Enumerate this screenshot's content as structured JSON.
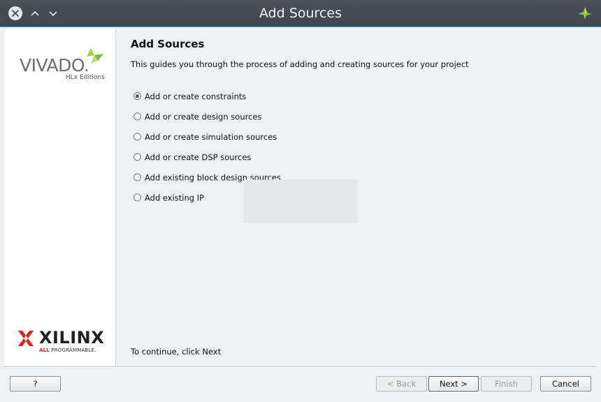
{
  "window": {
    "title": "Add Sources"
  },
  "sidebar": {
    "vivado_wordmark": "VIVADO.",
    "vivado_edition": "HLx Editions",
    "xilinx_wordmark": "XILINX",
    "xilinx_tagline_all": "ALL",
    "xilinx_tagline_rest": " PROGRAMMABLE."
  },
  "main": {
    "heading": "Add Sources",
    "description": "This guides you through the process of adding and creating sources for your project",
    "options": [
      {
        "label": "Add or create constraints",
        "selected": true
      },
      {
        "label": "Add or create design sources",
        "selected": false
      },
      {
        "label": "Add or create simulation sources",
        "selected": false
      },
      {
        "label": "Add or create DSP sources",
        "selected": false
      },
      {
        "label": "Add existing block design sources",
        "selected": false
      },
      {
        "label": "Add existing IP",
        "selected": false
      }
    ],
    "continue_hint": "To continue, click Next"
  },
  "buttons": {
    "help": "?",
    "back": "< Back",
    "next": "Next >",
    "finish": "Finish",
    "cancel": "Cancel"
  },
  "colors": {
    "titlebar": "#40464d",
    "accent": "#3daee9",
    "vivado_leaf": "#8dc63f",
    "xilinx_red": "#e2231a"
  }
}
